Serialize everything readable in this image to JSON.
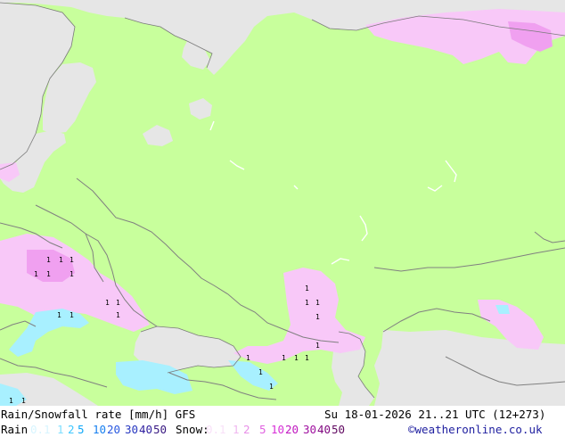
{
  "title": "Rain/Snowfall rate [mm/h] GFS",
  "valid_time": "Su 18-01-2026 21..21 UTC (12+273)",
  "rain_label": "Rain",
  "snow_label": "Snow:",
  "rain_legend": [
    {
      "text": "0.1",
      "color": "#d8f5ff"
    },
    {
      "text": "1",
      "color": "#80dfff"
    },
    {
      "text": "2",
      "color": "#40c8ff"
    },
    {
      "text": "5",
      "color": "#10a8f8"
    },
    {
      "text": "10",
      "color": "#1880f0"
    },
    {
      "text": "20",
      "color": "#2858e0"
    },
    {
      "text": "30",
      "color": "#2838c0"
    },
    {
      "text": "40",
      "color": "#3020a0"
    },
    {
      "text": "50",
      "color": "#381880"
    }
  ],
  "snow_legend": [
    {
      "text": "0.1",
      "color": "#f8e0f8"
    },
    {
      "text": "1",
      "color": "#f0b8f0"
    },
    {
      "text": "2",
      "color": "#e890e8"
    },
    {
      "text": "5",
      "color": "#e060e0"
    },
    {
      "text": "10",
      "color": "#d830d8"
    },
    {
      "text": "20",
      "color": "#c018c0"
    },
    {
      "text": "30",
      "color": "#a010a0"
    },
    {
      "text": "40",
      "color": "#800880"
    },
    {
      "text": "50",
      "color": "#600860"
    }
  ],
  "credit": "©weatheronline.co.uk",
  "colors": {
    "land_dry": "#c8ff9c",
    "outside_domain": "#e6e6e6",
    "snow_light": "#f8c8f8",
    "snow_moderate": "#f0a0f0",
    "rain_light": "#a8f0ff",
    "border": "#808080",
    "marker": "#000000"
  },
  "snow_markers": "1"
}
